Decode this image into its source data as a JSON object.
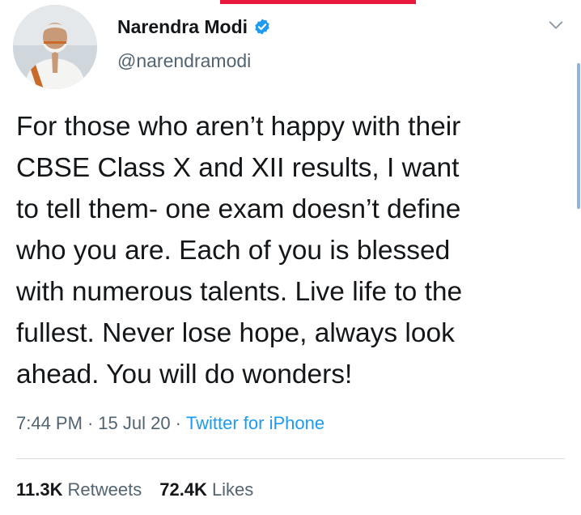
{
  "tweet": {
    "author": {
      "display_name": "Narendra Modi",
      "handle": "@narendramodi",
      "verified": true,
      "avatar_icon": "profile-photo"
    },
    "menu_icon": "chevron-down-icon",
    "text": "For those who aren’t happy with their\nCBSE Class X and XII results, I want\nto tell them- one exam doesn’t define\nwho you are. Each of you is blessed\nwith numerous talents. Live life to the\nfullest. Never lose hope, always look\nahead. You will do wonders!",
    "time": "7:44 PM",
    "date": "15 Jul 20",
    "separator": "·",
    "source": "Twitter for iPhone",
    "retweets_count": "11.3K",
    "retweets_label": "Retweets",
    "likes_count": "72.4K",
    "likes_label": "Likes"
  },
  "colors": {
    "accent": "#1d9bf0",
    "text_primary": "#14171a",
    "text_secondary": "#536471",
    "top_strip": "#e8193c"
  }
}
